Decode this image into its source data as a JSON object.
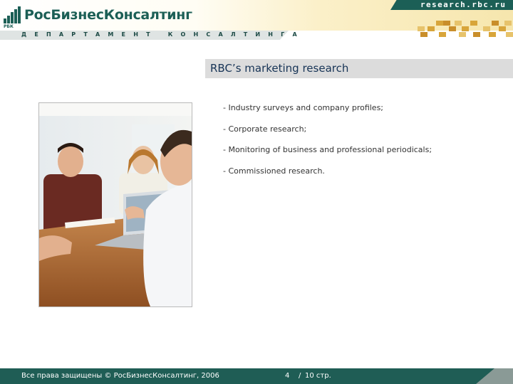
{
  "header": {
    "logo_name": "РосБизнесКонсалтинг",
    "logo_abbr": "РБК",
    "department": "ДЕПАРТАМЕНТ КОНСАЛТИНГА",
    "url": "research.rbc.ru"
  },
  "slide": {
    "title": "RBC’s marketing research",
    "bullets": [
      "- Industry surveys and company profiles;",
      "- Corporate research;",
      "- Monitoring of business and professional periodicals;",
      "- Commissioned research."
    ]
  },
  "footer": {
    "copyright": "Все права защищены © РосБизнесКонсалтинг, 2006",
    "page_current": "4",
    "page_separator": "/",
    "page_total": "10 стр."
  },
  "colors": {
    "brand_green": "#1f5d55",
    "tile_gold": "#d8a53a",
    "title_text": "#173456"
  }
}
